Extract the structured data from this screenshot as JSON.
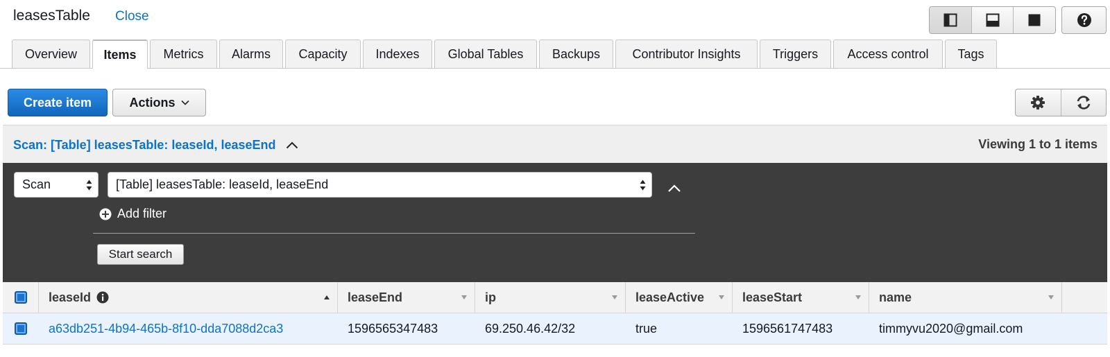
{
  "header": {
    "table_name": "leasesTable",
    "close_label": "Close"
  },
  "tabs": [
    {
      "label": "Overview"
    },
    {
      "label": "Items"
    },
    {
      "label": "Metrics"
    },
    {
      "label": "Alarms"
    },
    {
      "label": "Capacity"
    },
    {
      "label": "Indexes"
    },
    {
      "label": "Global Tables"
    },
    {
      "label": "Backups"
    },
    {
      "label": "Contributor Insights"
    },
    {
      "label": "Triggers"
    },
    {
      "label": "Access control"
    },
    {
      "label": "Tags"
    }
  ],
  "active_tab": "Items",
  "toolbar": {
    "create_label": "Create item",
    "actions_label": "Actions"
  },
  "scan": {
    "summary": "Scan: [Table] leasesTable: leaseId, leaseEnd",
    "viewing": "Viewing 1 to 1 items",
    "mode_value": "Scan",
    "target_value": "[Table] leasesTable: leaseId, leaseEnd",
    "add_filter_label": "Add filter",
    "start_search_label": "Start search"
  },
  "table": {
    "columns": [
      "leaseId",
      "leaseEnd",
      "ip",
      "leaseActive",
      "leaseStart",
      "name"
    ],
    "rows": [
      {
        "leaseId": "a63db251-4b94-465b-8f10-dda7088d2ca3",
        "leaseEnd": "1596565347483",
        "ip": "69.250.46.42/32",
        "leaseActive": "true",
        "leaseStart": "1596561747483",
        "name": "timmyvu2020@gmail.com"
      }
    ]
  },
  "colors": {
    "primary_blue": "#1a73d1",
    "link_blue": "#0b73c9",
    "dark_panel": "#3d3d3d",
    "selected_row": "#eaf3fd"
  }
}
